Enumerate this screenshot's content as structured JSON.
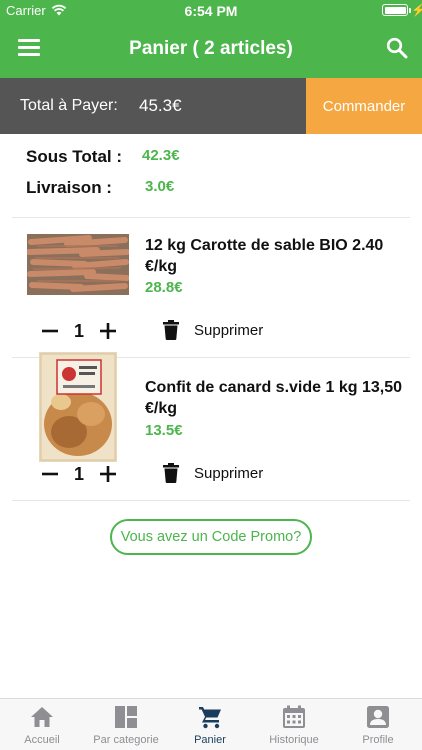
{
  "status_bar": {
    "carrier": "Carrier",
    "time": "6:54 PM"
  },
  "navbar": {
    "title": "Panier ( 2 articles)"
  },
  "total_bar": {
    "label": "Total à Payer:",
    "amount": "45.3€",
    "order_button": "Commander"
  },
  "summary": {
    "subtotal_label": "Sous Total :",
    "subtotal_value": "42.3€",
    "delivery_label": "Livraison :",
    "delivery_value": "3.0€"
  },
  "items": [
    {
      "title": "12 kg Carotte de sable BIO  2.40 €/kg",
      "price": "28.8€",
      "quantity": "1",
      "delete_label": "Supprimer"
    },
    {
      "title": "Confit de canard  s.vide 1 kg 13,50 €/kg",
      "price": "13.5€",
      "quantity": "1",
      "delete_label": "Supprimer"
    }
  ],
  "promo": {
    "label": "Vous avez un Code Promo?"
  },
  "tabs": [
    {
      "label": "Accueil",
      "icon": "home-icon",
      "active": false
    },
    {
      "label": "Par categorie",
      "icon": "categories-icon",
      "active": false
    },
    {
      "label": "Panier",
      "icon": "cart-icon",
      "active": true
    },
    {
      "label": "Historique",
      "icon": "calendar-icon",
      "active": false
    },
    {
      "label": "Profile",
      "icon": "profile-icon",
      "active": false
    }
  ],
  "colors": {
    "primary_green": "#4cb54c",
    "total_bar": "#555555",
    "order_orange": "#f5a742",
    "active_tab": "#1a3d5c"
  }
}
